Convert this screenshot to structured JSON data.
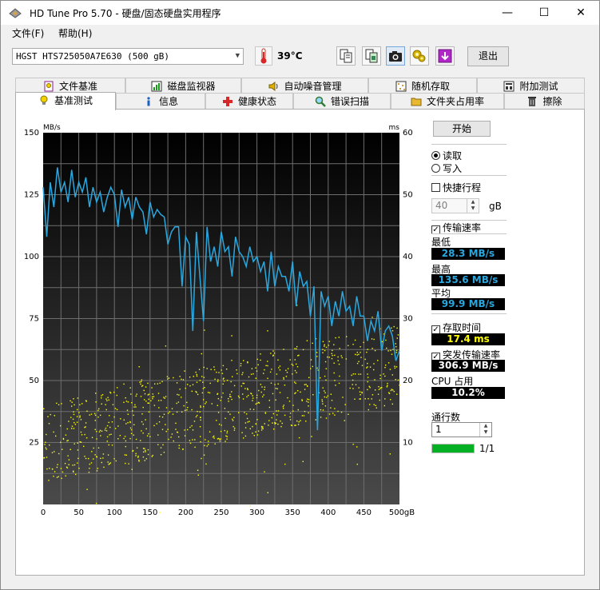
{
  "window": {
    "title": "HD Tune Pro 5.70 - 硬盘/固态硬盘实用程序",
    "minimize_glyph": "—",
    "maximize_glyph": "☐",
    "close_glyph": "✕"
  },
  "menu": [
    "文件(F)",
    "帮助(H)"
  ],
  "toolbar": {
    "drive": "HGST HTS725050A7E630 (500 gB)",
    "temperature": "39°C",
    "icons": [
      "copy-info-icon",
      "copy-screenshot-icon",
      "camera-icon",
      "options-icon",
      "save-icon"
    ],
    "exit_label": "退出"
  },
  "tabs_top": [
    {
      "label": "文件基准",
      "icon": "file-benchmark-icon"
    },
    {
      "label": "磁盘监视器",
      "icon": "disk-monitor-icon"
    },
    {
      "label": "自动噪音管理",
      "icon": "speaker-icon"
    },
    {
      "label": "随机存取",
      "icon": "random-access-icon"
    },
    {
      "label": "附加测试",
      "icon": "extra-tests-icon"
    }
  ],
  "tabs_bottom": [
    {
      "label": "基准测试",
      "icon": "lightbulb-icon",
      "active": true
    },
    {
      "label": "信息",
      "icon": "info-icon"
    },
    {
      "label": "健康状态",
      "icon": "health-cross-icon"
    },
    {
      "label": "错误扫描",
      "icon": "magnifier-icon"
    },
    {
      "label": "文件夹占用率",
      "icon": "folder-icon"
    },
    {
      "label": "擦除",
      "icon": "erase-bin-icon"
    }
  ],
  "chart_data": {
    "type": "line",
    "y_left_label": "MB/s",
    "y_right_label": "ms",
    "x_ticks": [
      "0",
      "50",
      "100",
      "150",
      "200",
      "250",
      "300",
      "350",
      "400",
      "450",
      "500gB"
    ],
    "y_left_ticks": [
      "150",
      "125",
      "100",
      "75",
      "50",
      "25"
    ],
    "y_right_ticks": [
      "60",
      "50",
      "40",
      "30",
      "20",
      "10"
    ],
    "xlim": [
      0,
      500
    ],
    "ylim_left": [
      0,
      150
    ],
    "ylim_right": [
      0,
      60
    ],
    "grid": true,
    "series": [
      {
        "color": "#29a8e0",
        "x": [
          0,
          5,
          10,
          15,
          20,
          25,
          30,
          35,
          40,
          45,
          50,
          55,
          60,
          65,
          70,
          75,
          80,
          85,
          90,
          95,
          100,
          105,
          110,
          115,
          120,
          125,
          130,
          135,
          140,
          145,
          150,
          155,
          160,
          165,
          170,
          175,
          180,
          185,
          190,
          195,
          200,
          205,
          210,
          215,
          220,
          225,
          230,
          235,
          240,
          245,
          250,
          255,
          260,
          265,
          270,
          275,
          280,
          285,
          290,
          295,
          300,
          305,
          310,
          315,
          320,
          325,
          330,
          335,
          340,
          345,
          350,
          355,
          360,
          365,
          370,
          375,
          380,
          385,
          390,
          395,
          400,
          405,
          410,
          415,
          420,
          425,
          430,
          435,
          440,
          445,
          450,
          455,
          460,
          465,
          470,
          475,
          480,
          485,
          490,
          495,
          500
        ],
        "y": [
          128,
          108,
          130,
          120,
          136,
          126,
          130,
          122,
          135,
          124,
          130,
          126,
          132,
          120,
          128,
          122,
          126,
          118,
          124,
          128,
          125,
          112,
          127,
          120,
          124,
          115,
          124,
          120,
          118,
          109,
          122,
          116,
          119,
          117,
          116,
          105,
          110,
          112,
          112,
          88,
          108,
          105,
          70,
          110,
          92,
          74,
          112,
          98,
          104,
          96,
          110,
          102,
          104,
          92,
          108,
          102,
          100,
          96,
          104,
          98,
          100,
          94,
          98,
          86,
          102,
          88,
          96,
          92,
          92,
          86,
          98,
          80,
          94,
          88,
          90,
          76,
          88,
          30,
          86,
          80,
          84,
          72,
          82,
          76,
          86,
          78,
          80,
          72,
          84,
          76,
          76,
          66,
          74,
          70,
          78,
          62,
          70,
          72,
          68,
          58,
          62
        ]
      }
    ],
    "access_points": {
      "color": "#ffff00",
      "description": "access time scatter in ms"
    }
  },
  "side": {
    "start_label": "开始",
    "read_label": "读取",
    "write_label": "写入",
    "short_stroke_label": "快捷行程",
    "short_stroke_value": "40",
    "short_stroke_unit": "gB",
    "transfer_rate_label": "传输速率",
    "min_label": "最低",
    "min_value": "28.3 MB/s",
    "max_label": "最高",
    "max_value": "135.6 MB/s",
    "avg_label": "平均",
    "avg_value": "99.9 MB/s",
    "access_time_label": "存取时间",
    "access_time_value": "17.4 ms",
    "burst_label": "突发传输速率",
    "burst_value": "306.9 MB/s",
    "cpu_label": "CPU 占用",
    "cpu_value": "10.2%",
    "threads_label": "通行数",
    "threads_value": "1",
    "progress_text": "1/1",
    "progress_fraction": 1.0,
    "colors": {
      "blue": "#29a8e0",
      "yellow": "#ffff00",
      "white": "#ffffff"
    }
  }
}
